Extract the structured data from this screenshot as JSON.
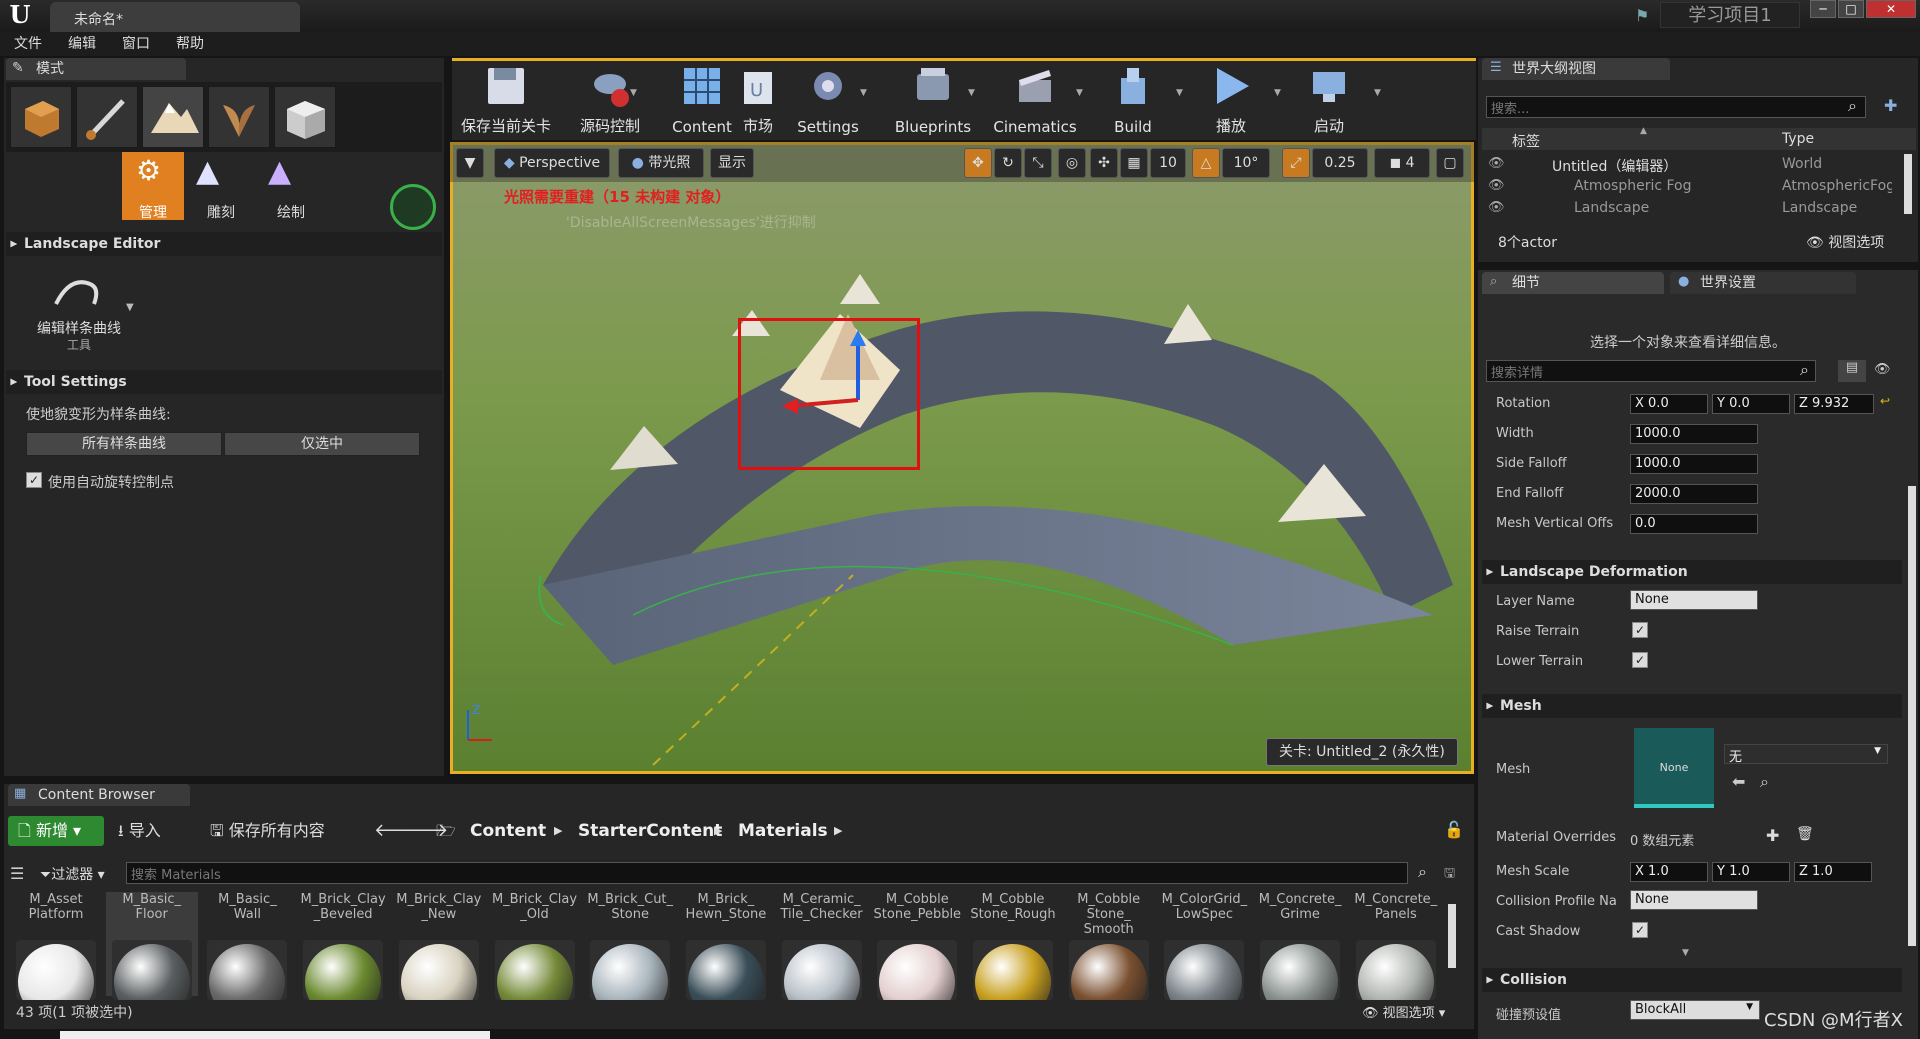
{
  "window": {
    "doc_tab": "未命名*",
    "project": "学习项目1",
    "min": "─",
    "max": "□",
    "close": "✕"
  },
  "menu": [
    "文件",
    "编辑",
    "窗口",
    "帮助"
  ],
  "modes": {
    "tab": "模式",
    "sub": [
      "管理",
      "雕刻",
      "绘制"
    ],
    "landscape_editor": "Landscape Editor",
    "tool_label": "编辑样条曲线",
    "tool_sub": "工具",
    "tool_settings": "Tool Settings",
    "deform_label": "使地貌变形为样条曲线:",
    "all_splines": "所有样条曲线",
    "selected_only": "仅选中",
    "auto_rotate": "使用自动旋转控制点"
  },
  "toolbar": [
    {
      "label": "保存当前关卡",
      "icon": "save-icon"
    },
    {
      "label": "源码控制",
      "icon": "source-control-icon"
    },
    {
      "label": "Content",
      "icon": "content-icon"
    },
    {
      "label": "市场",
      "icon": "marketplace-icon"
    },
    {
      "label": "Settings",
      "icon": "settings-icon"
    },
    {
      "label": "Blueprints",
      "icon": "blueprints-icon"
    },
    {
      "label": "Cinematics",
      "icon": "cinematics-icon"
    },
    {
      "label": "Build",
      "icon": "build-icon"
    },
    {
      "label": "播放",
      "icon": "play-icon"
    },
    {
      "label": "启动",
      "icon": "launch-icon"
    }
  ],
  "viewport": {
    "perspective": "Perspective",
    "lit": "带光照",
    "show": "显示",
    "grid": "10",
    "rot": "10°",
    "scale": "0.25",
    "cam": "4",
    "warning": "光照需要重建（15 未构建 对象）",
    "suppress": "'DisableAllScreenMessages'进行抑制",
    "level": "关卡:  Untitled_2 (永久性)"
  },
  "outliner": {
    "tab": "世界大纲视图",
    "search_placeholder": "搜索...",
    "col_label": "标签",
    "col_type": "Type",
    "rows": [
      {
        "label": "Untitled（编辑器）",
        "type": "World"
      },
      {
        "label": "Atmospheric Fog",
        "type": "AtmosphericFog"
      },
      {
        "label": "Landscape",
        "type": "Landscape"
      }
    ],
    "count": "8个actor",
    "view_options": "视图选项"
  },
  "details": {
    "tab": "细节",
    "world_tab": "世界设置",
    "hint": "选择一个对象来查看详细信息。",
    "search_placeholder": "搜索详情",
    "rotation": {
      "name": "Rotation",
      "x": "X  0.0",
      "y": "Y  0.0",
      "z": "Z  9.932"
    },
    "width": {
      "name": "Width",
      "value": "1000.0"
    },
    "side_falloff": {
      "name": "Side Falloff",
      "value": "1000.0"
    },
    "end_falloff": {
      "name": "End Falloff",
      "value": "2000.0"
    },
    "mesh_vertical": {
      "name": "Mesh Vertical Offs",
      "value": "0.0"
    },
    "deform_section": "Landscape Deformation",
    "layer_name": {
      "name": "Layer Name",
      "value": "None"
    },
    "raise_terrain": "Raise Terrain",
    "lower_terrain": "Lower Terrain",
    "mesh_section": "Mesh",
    "mesh": {
      "name": "Mesh",
      "thumb": "None",
      "value": "无"
    },
    "material_overrides": {
      "name": "Material Overrides",
      "value": "0 数组元素"
    },
    "mesh_scale": {
      "name": "Mesh Scale",
      "x": "X  1.0",
      "y": "Y  1.0",
      "z": "Z  1.0"
    },
    "collision_profile": {
      "name": "Collision Profile Na",
      "value": "None"
    },
    "cast_shadow": "Cast Shadow",
    "collision_section": "Collision",
    "collision_preset": {
      "name": "碰撞预设值",
      "value": "BlockAll"
    }
  },
  "content_browser": {
    "tab": "Content Browser",
    "new": "新增",
    "import": "导入",
    "save_all": "保存所有内容",
    "path": [
      "Content",
      "StarterContent",
      "Materials"
    ],
    "filter": "过滤器",
    "search_placeholder": "搜索 Materials",
    "items": [
      {
        "label": "M_Asset\nPlatform",
        "color": "#e8e8e8"
      },
      {
        "label": "M_Basic_\nFloor",
        "color": "#5a5e60"
      },
      {
        "label": "M_Basic_\nWall",
        "color": "#6a6a6a"
      },
      {
        "label": "M_Brick_Clay\n_Beveled",
        "color": "#6b8a30"
      },
      {
        "label": "M_Brick_Clay\n_New",
        "color": "#d8d2c0"
      },
      {
        "label": "M_Brick_Clay\n_Old",
        "color": "#748a38"
      },
      {
        "label": "M_Brick_Cut_\nStone",
        "color": "#a8b4bc"
      },
      {
        "label": "M_Brick_\nHewn_Stone",
        "color": "#3a4e58"
      },
      {
        "label": "M_Ceramic_\nTile_Checker",
        "color": "#b8c0c8"
      },
      {
        "label": "M_Cobble\nStone_Pebble",
        "color": "#e4cfcf"
      },
      {
        "label": "M_Cobble\nStone_Rough",
        "color": "#c8a020"
      },
      {
        "label": "M_Cobble\nStone_\nSmooth",
        "color": "#7a5030"
      },
      {
        "label": "M_ColorGrid_\nLowSpec",
        "color": "#7a8288"
      },
      {
        "label": "M_Concrete_\nGrime",
        "color": "#8a9290"
      },
      {
        "label": "M_Concrete_\nPanels",
        "color": "#b0b4b0"
      }
    ],
    "status": "43 项(1 项被选中)",
    "view_options": "视图选项"
  },
  "watermark": "CSDN @M行者X"
}
